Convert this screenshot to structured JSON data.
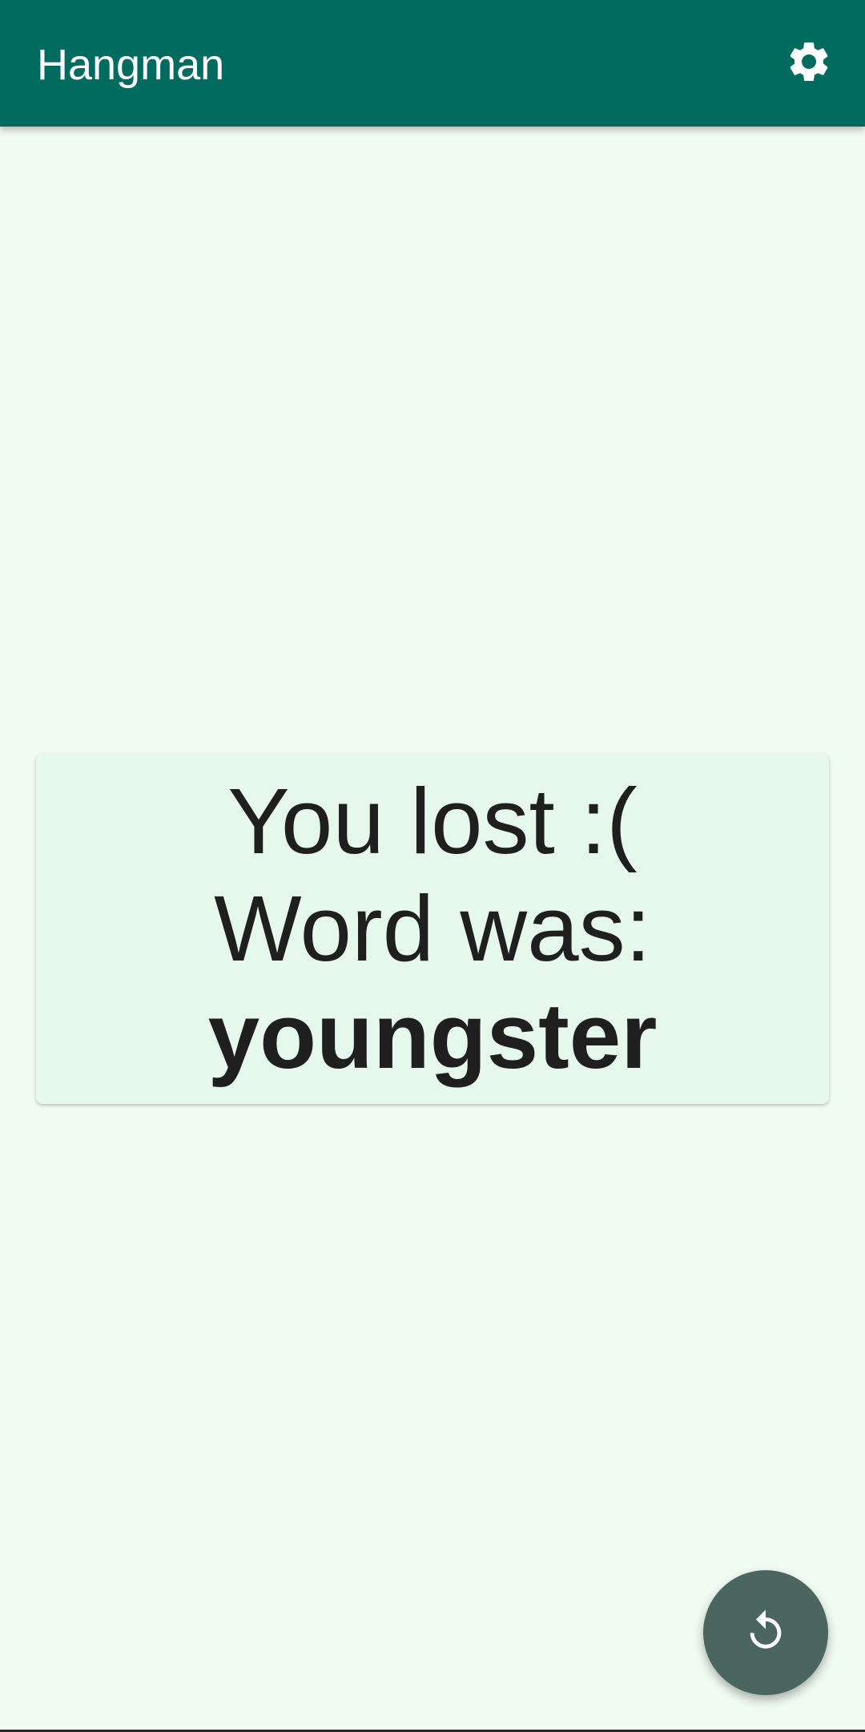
{
  "app_bar": {
    "title": "Hangman",
    "background_color": "#006b5e",
    "settings_icon": "gear-icon"
  },
  "result": {
    "line1": "You lost :(",
    "line2": "Word was:",
    "word": "youngster"
  },
  "fab": {
    "icon": "restart-icon",
    "color": "#4b6560"
  }
}
